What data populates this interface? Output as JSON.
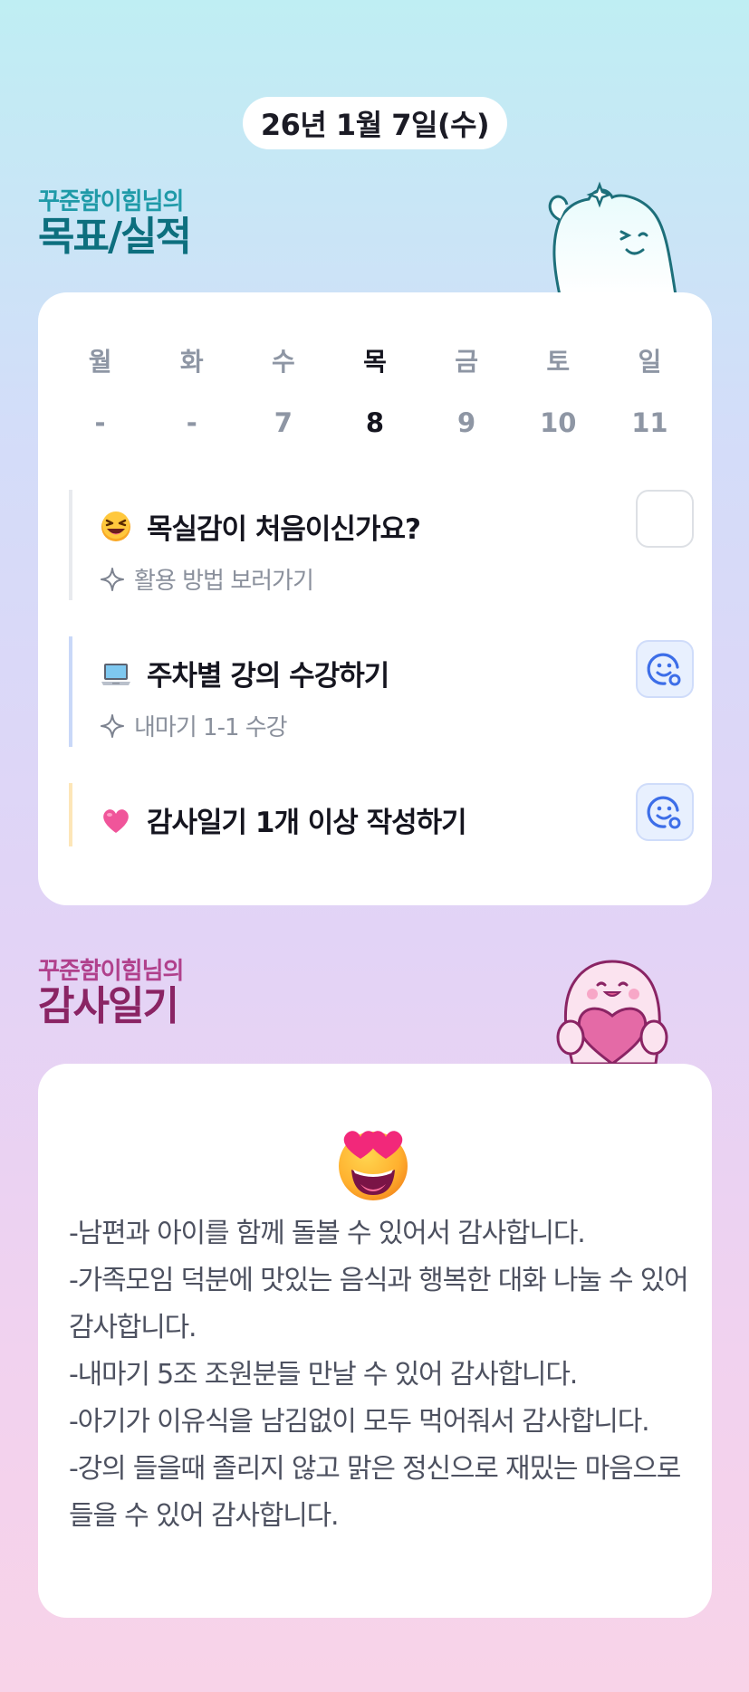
{
  "header": {
    "date": "26년 1월 7일(수)"
  },
  "goals_section": {
    "owner": "꾸준함이힘님의",
    "title": "목표/실적"
  },
  "week": {
    "days": [
      "월",
      "화",
      "수",
      "목",
      "금",
      "토",
      "일"
    ],
    "dates": [
      "-",
      "-",
      "7",
      "8",
      "9",
      "10",
      "11"
    ],
    "active_index": 3
  },
  "goals": [
    {
      "emoji": "laughing-face",
      "title": "목실감이 처음이신가요?",
      "sub": "활용 방법 보러가기",
      "status": "unchecked"
    },
    {
      "emoji": "laptop",
      "title": "주차별 강의 수강하기",
      "sub": "내마기 1-1 수강",
      "status": "done"
    },
    {
      "emoji": "pink-heart",
      "title": "감사일기 1개 이상 작성하기",
      "sub": "",
      "status": "done"
    }
  ],
  "diary_section": {
    "owner": "꾸준함이힘님의",
    "title": "감사일기",
    "emoji": "heart-eyes-face",
    "lines": [
      "-남편과 아이를 함께 돌볼 수 있어서 감사합니다.",
      "-가족모임 덕분에 맛있는 음식과 행복한 대화 나눌 수 있어 감사합니다.",
      "-내마기 5조 조원분들 만날 수 있어 감사합니다.",
      "-아기가 이유식을 남김없이 모두 먹어줘서 감사합니다.",
      "-강의 들을때 졸리지 않고 맑은 정신으로 재밌는 마음으로 들을 수 있어 감사합니다."
    ]
  },
  "colors": {
    "goals_title": "#0d6f7e",
    "diary_title": "#8a2464",
    "done_icon": "#3d6ee8"
  }
}
